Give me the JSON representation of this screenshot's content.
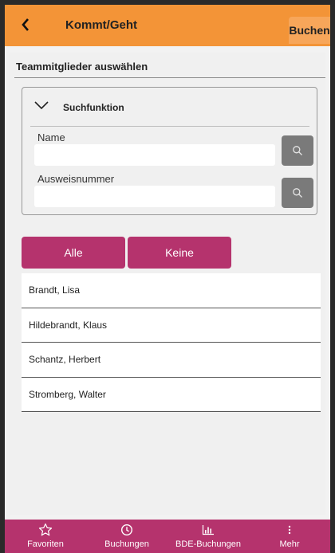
{
  "header": {
    "title": "Kommt/Geht",
    "action_label": "Buchen",
    "accent": "#f39437"
  },
  "section": {
    "title": "Teammitglieder auswählen"
  },
  "search": {
    "toggle_label": "Suchfunktion",
    "name_label": "Name",
    "name_value": "",
    "badge_label": "Ausweisnummer",
    "badge_value": ""
  },
  "selection": {
    "all_label": "Alle",
    "none_label": "Keine",
    "color": "#b5336d"
  },
  "members": [
    "Brandt, Lisa",
    "Hildebrandt, Klaus",
    "Schantz, Herbert",
    "Stromberg, Walter"
  ],
  "tabbar": {
    "tabs": [
      {
        "label": "Favoriten",
        "icon": "star-icon"
      },
      {
        "label": "Buchungen",
        "icon": "clock-icon"
      },
      {
        "label": "BDE-Buchungen",
        "icon": "bar-chart-icon"
      },
      {
        "label": "Mehr",
        "icon": "more-icon"
      }
    ]
  }
}
